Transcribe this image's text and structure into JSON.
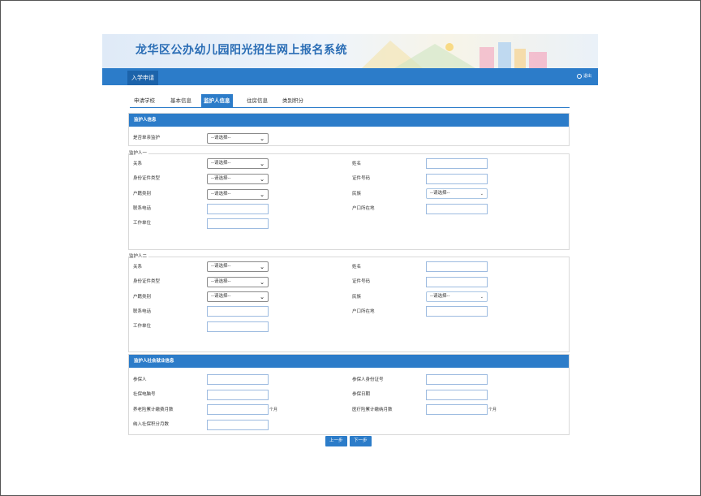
{
  "header": {
    "title": "龙华区公办幼儿园阳光招生网上报名系统"
  },
  "nav": {
    "active_item": "入学申请",
    "exit_label": "退出",
    "exit_icon": "power-icon"
  },
  "tabs": [
    {
      "label": "申请学校",
      "active": false
    },
    {
      "label": "基本信息",
      "active": false
    },
    {
      "label": "监护人信息",
      "active": true
    },
    {
      "label": "住房信息",
      "active": false
    },
    {
      "label": "类别积分",
      "active": false
    }
  ],
  "guardian_section": {
    "header": "监护人信息",
    "single_parent_label": "是否单亲监护",
    "single_parent_value": "--请选择--"
  },
  "guardian1": {
    "legend": "监护人一",
    "relation_label": "关系",
    "relation_value": "--请选择--",
    "id_type_label": "身份证件类型",
    "id_type_value": "--请选择--",
    "hukou_type_label": "户籍类别",
    "hukou_type_value": "--请选择--",
    "phone_label": "联系电话",
    "workplace_label": "工作单位",
    "name_label": "姓名",
    "id_number_label": "证件号码",
    "ethnicity_label": "民族",
    "ethnicity_value": "--请选择--",
    "hukou_place_label": "户口所在地"
  },
  "guardian2": {
    "legend": "监护人二",
    "relation_label": "关系",
    "relation_value": "--请选择--",
    "id_type_label": "身份证件类型",
    "id_type_value": "--请选择--",
    "hukou_type_label": "户籍类别",
    "hukou_type_value": "--请选择--",
    "phone_label": "联系电话",
    "workplace_label": "工作单位",
    "name_label": "姓名",
    "id_number_label": "证件号码",
    "ethnicity_label": "民族",
    "ethnicity_value": "--请选择--",
    "hukou_place_label": "户口所在地"
  },
  "social_security": {
    "header": "监护人社会就业信息",
    "insured_label": "参保人",
    "ss_number_label": "社保电脑号",
    "pension_months_label": "养老险累计缴费月数",
    "included_months_label": "纳入社保积分月数",
    "insured_id_label": "参保人身份证号",
    "insured_date_label": "参保日期",
    "medical_months_label": "医疗险累计缴纳月数",
    "month_unit": "个月"
  },
  "buttons": {
    "prev": "上一步",
    "next": "下一步"
  },
  "colors": {
    "primary": "#2c7cc9",
    "banner_title": "#2a6db5"
  }
}
